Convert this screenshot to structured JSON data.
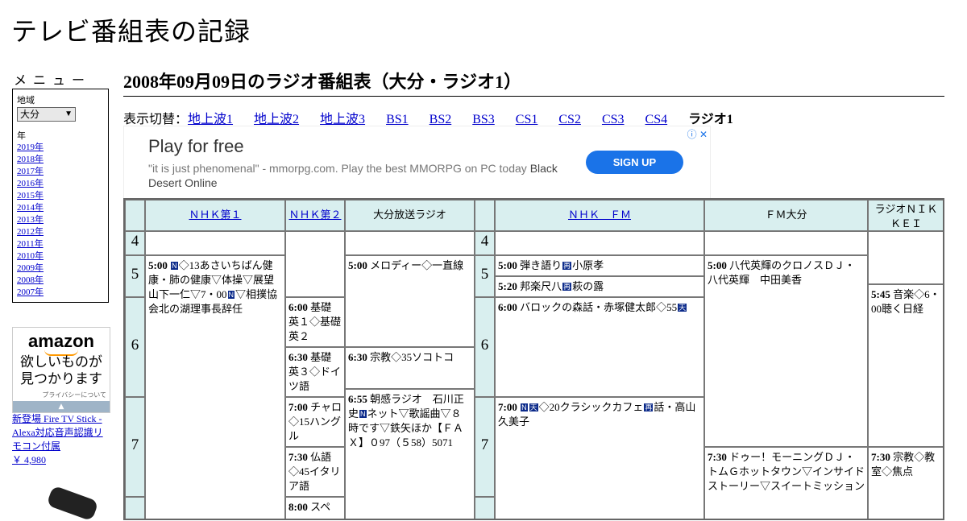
{
  "site_title": "テレビ番組表の記録",
  "sidebar": {
    "menu_label": "メニュー",
    "region_label": "地域",
    "region_value": "大分",
    "year_label": "年",
    "years": [
      "2019年",
      "2018年",
      "2017年",
      "2016年",
      "2015年",
      "2014年",
      "2013年",
      "2012年",
      "2011年",
      "2010年",
      "2009年",
      "2008年",
      "2007年"
    ],
    "ad_logo": "amazon",
    "ad_text_1": "欲しいものが",
    "ad_text_2": "見つかります",
    "ad_privacy": "プライバシーについて",
    "product_text": "新登場 Fire TV Stick - Alexa対応音声認識リモコン付属",
    "product_price": "￥ 4,980"
  },
  "page_title": "2008年09月09日のラジオ番組表（大分・ラジオ1）",
  "switcher": {
    "label": "表示切替：",
    "links": [
      "地上波1",
      "地上波2",
      "地上波3",
      "BS1",
      "BS2",
      "BS3",
      "CS1",
      "CS2",
      "CS3",
      "CS4"
    ],
    "current": "ラジオ1"
  },
  "ad": {
    "title": "Play for free",
    "desc": "\"it is just phenomenal\" - mmorpg.com. Play the best MMORPG on PC today ",
    "desc_brand": "Black Desert Online",
    "button": "SIGN UP",
    "icons": "ⓘ ✕"
  },
  "grid": {
    "channels": [
      "ＮＨＫ第１",
      "ＮＨＫ第２",
      "大分放送ラジオ",
      "ＮＨＫ　ＦＭ",
      "ＦＭ大分",
      "ラジオＮＩＫＫＥＩ"
    ],
    "hours": [
      "4",
      "5",
      "6",
      "7"
    ],
    "programs": {
      "nhk1_500": {
        "time": "5:00",
        "pre": "",
        "ic1": "N",
        "mid": "◇13あさいちばん健康・肺の健康▽体操▽展望　山下一仁▽7・00",
        "ic2": "N",
        "post": "▽相撲協会北の湖理事長辞任"
      },
      "nhk2_600": {
        "time": "6:00",
        "text": "基礎英１◇基礎英２"
      },
      "nhk2_630": {
        "time": "6:30",
        "text": "基礎英３◇ドイツ語"
      },
      "nhk2_700": {
        "time": "7:00",
        "text": "チャロ◇15ハングル"
      },
      "nhk2_730": {
        "time": "7:30",
        "text": "仏語◇45イタリア語"
      },
      "nhk2_800": {
        "time": "8:00",
        "text": "スペ"
      },
      "obs_500": {
        "time": "5:00",
        "text": "メロディー◇一直線"
      },
      "obs_630": {
        "time": "6:30",
        "text": "宗教◇35ソコトコ"
      },
      "obs_655": {
        "time": "6:55",
        "pre": "朝感ラジオ　石川正史",
        "ic": "N",
        "post": "ネット▽歌謡曲▽８時です▽鉄矢ほか【ＦＡＸ】０97（５58）5071"
      },
      "fm_500": {
        "time": "5:00",
        "pre": "弾き語り",
        "ic": "再",
        "post": "小原孝"
      },
      "fm_520": {
        "time": "5:20",
        "pre": "邦楽尺八",
        "ic": "再",
        "post": "萩の露"
      },
      "fm_600": {
        "time": "6:00",
        "pre": "バロックの森話・赤塚健太郎◇55",
        "ic": "天",
        "post": ""
      },
      "fm_700": {
        "time": "7:00",
        "ic1": "N",
        "ic2": "天",
        "mid": "◇20クラシックカフェ",
        "ic3": "再",
        "post": "話・高山久美子"
      },
      "fmo_500": {
        "time": "5:00",
        "text": "八代英輝のクロノスＤＪ・八代英輝　中田美香"
      },
      "fmo_730": {
        "time": "7:30",
        "text": "ドゥー！モーニングＤＪ・トムＧホットタウン▽インサイドストーリー▽スイートミッション"
      },
      "nik_545": {
        "time": "5:45",
        "text": "音楽◇6・00聴く日経"
      },
      "nik_730": {
        "time": "7:30",
        "text": "宗教◇教室◇焦点"
      }
    }
  }
}
